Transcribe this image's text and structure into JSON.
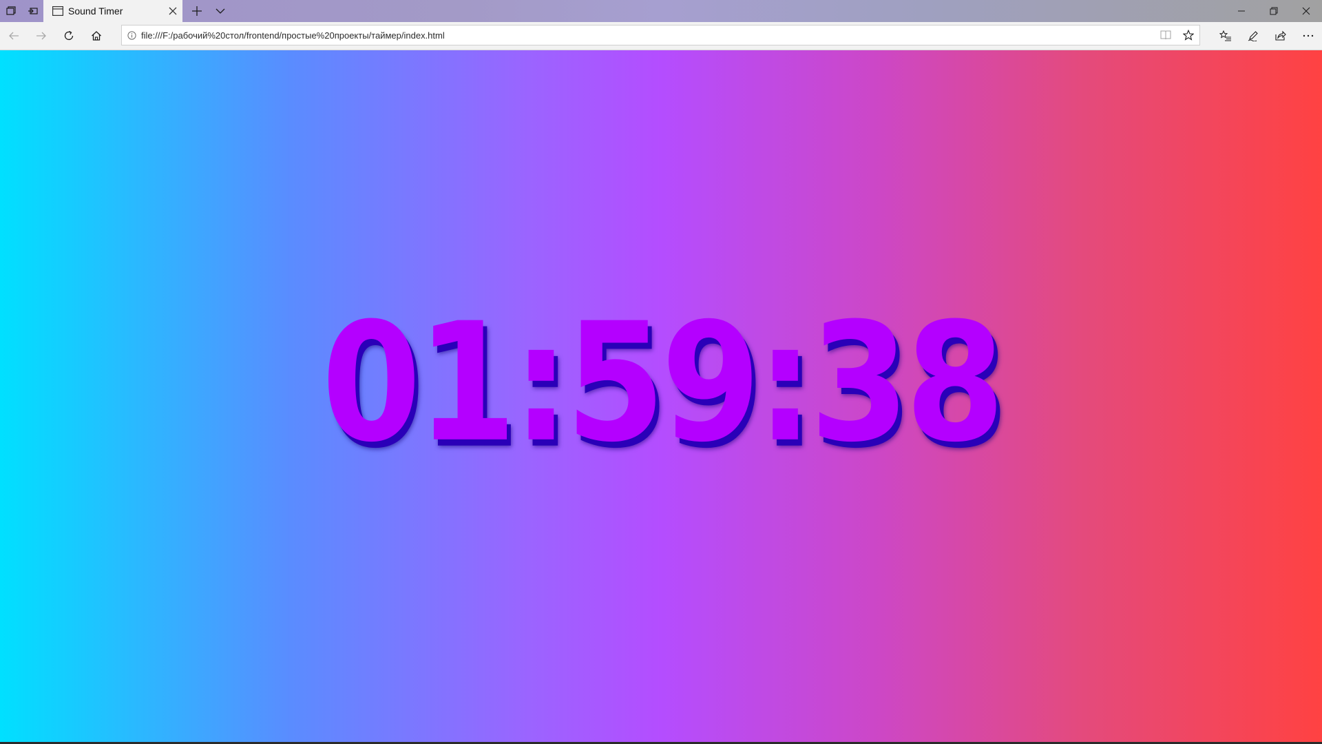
{
  "browser": {
    "tab": {
      "title": "Sound Timer",
      "favicon": "page-icon",
      "close_icon": "close-icon"
    },
    "icons": {
      "set_aside_tabs": "tabs-aside-icon",
      "show_set_aside": "restore-tabs-icon",
      "new_tab": "plus-icon",
      "tab_list": "chevron-down-icon",
      "minimize": "minimize-icon",
      "maximize": "restore-icon",
      "close": "close-icon",
      "back": "arrow-left-icon",
      "forward": "arrow-right-icon",
      "refresh": "refresh-icon",
      "home": "home-icon",
      "site_info": "info-icon",
      "reading_view": "book-icon",
      "favorite": "star-icon",
      "favorites_hub": "favorites-list-icon",
      "notes": "pen-icon",
      "share": "share-icon",
      "more": "ellipsis-icon"
    },
    "address": {
      "url": "file:///F:/рабочий%20стол/frontend/простые%20проекты/таймер/index.html"
    }
  },
  "page": {
    "timer_text": "01:59:38",
    "timer": {
      "hours": "01",
      "minutes": "59",
      "seconds": "38"
    },
    "colors": {
      "background_gradient": [
        "#00e0ff",
        "#b44dff",
        "#ff4242"
      ],
      "timer_fill": "#b400ff",
      "timer_shadow": "#2a00b8"
    }
  }
}
